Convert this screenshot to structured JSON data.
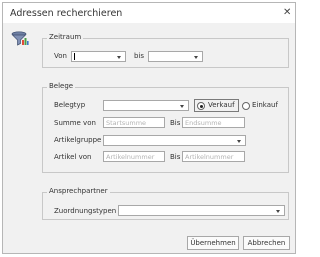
{
  "window": {
    "title": "Adressen recherchieren"
  },
  "icons": {
    "app": "address-search-icon",
    "close": "close-icon"
  },
  "zeitraum": {
    "legend": "Zeitraum",
    "von_label": "Von",
    "bis_label": "bis",
    "von_value": "",
    "bis_value": ""
  },
  "belege": {
    "legend": "Belege",
    "belegtyp_label": "Belegtyp",
    "belegtyp_value": "",
    "verkauf_label": "Verkauf",
    "einkauf_label": "Einkauf",
    "selected_option": "Verkauf",
    "summe_label": "Summe von",
    "summe_from_placeholder": "Startsumme",
    "summe_bis_label": "Bis",
    "summe_to_placeholder": "Endsumme",
    "artikelgruppe_label": "Artikelgruppe",
    "artikelgruppe_value": "",
    "artikel_label": "Artikel von",
    "artikel_from_placeholder": "Artikelnummer",
    "artikel_bis_label": "Bis",
    "artikel_to_placeholder": "Artikelnummer"
  },
  "ansprechpartner": {
    "legend": "Ansprechpartner",
    "zuordnungstypen_label": "Zuordnungstypen",
    "zuordnungstypen_value": ""
  },
  "buttons": {
    "ok": "Übernehmen",
    "cancel": "Abbrechen"
  }
}
